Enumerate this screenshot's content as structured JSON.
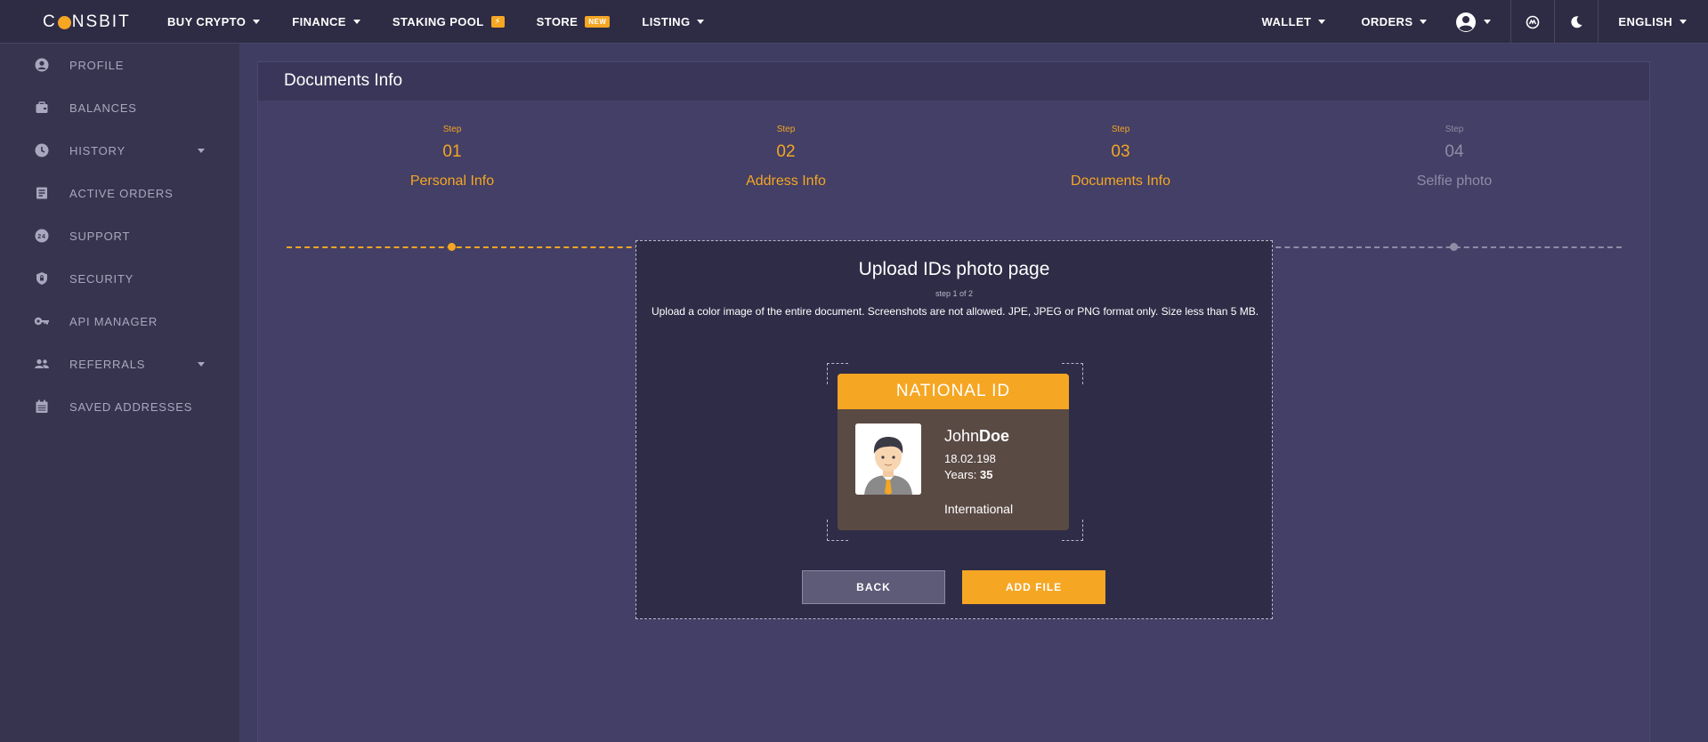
{
  "brand": {
    "logo_pre": "C",
    "logo_post": "NSBIT"
  },
  "nav": {
    "buy_crypto": "BUY CRYPTO",
    "finance": "FINANCE",
    "staking_pool": "STAKING POOL",
    "staking_badge": "⚡",
    "store": "STORE",
    "store_badge": "NEW",
    "listing": "LISTING",
    "wallet": "WALLET",
    "orders": "ORDERS",
    "language": "ENGLISH"
  },
  "sidebar": {
    "items": [
      {
        "label": "PROFILE",
        "icon": "profile-icon"
      },
      {
        "label": "BALANCES",
        "icon": "wallet-icon"
      },
      {
        "label": "HISTORY",
        "icon": "clock-icon"
      },
      {
        "label": "ACTIVE ORDERS",
        "icon": "orders-icon"
      },
      {
        "label": "SUPPORT",
        "icon": "support-24-icon"
      },
      {
        "label": "SECURITY",
        "icon": "shield-icon"
      },
      {
        "label": "API MANAGER",
        "icon": "key-icon"
      },
      {
        "label": "REFERRALS",
        "icon": "users-icon"
      },
      {
        "label": "SAVED ADDRESSES",
        "icon": "calendar-icon"
      }
    ]
  },
  "page": {
    "title": "Documents Info"
  },
  "stepper": {
    "steps": [
      {
        "caption": "Step",
        "number": "01",
        "name": "Personal Info"
      },
      {
        "caption": "Step",
        "number": "02",
        "name": "Address Info"
      },
      {
        "caption": "Step",
        "number": "03",
        "name": "Documents Info"
      },
      {
        "caption": "Step",
        "number": "04",
        "name": "Selfie photo"
      }
    ]
  },
  "upload": {
    "title": "Upload IDs photo page",
    "subtitle": "step 1 of 2",
    "description": "Upload a color image of the entire document. Screenshots are not allowed. JPE, JPEG or PNG format only. Size less than 5 MB.",
    "back_label": "BACK",
    "add_label": "ADD FILE"
  },
  "idcard": {
    "header": "NATIONAL ID",
    "first_name": "John",
    "last_name": "Doe",
    "date": "18.02.198",
    "years_label": "Years: ",
    "years_value": "35",
    "nationality": "International"
  },
  "colors": {
    "accent": "#f5a623",
    "bg": "#403d62",
    "nav": "#2e2b44",
    "sidebar": "#37344f"
  }
}
